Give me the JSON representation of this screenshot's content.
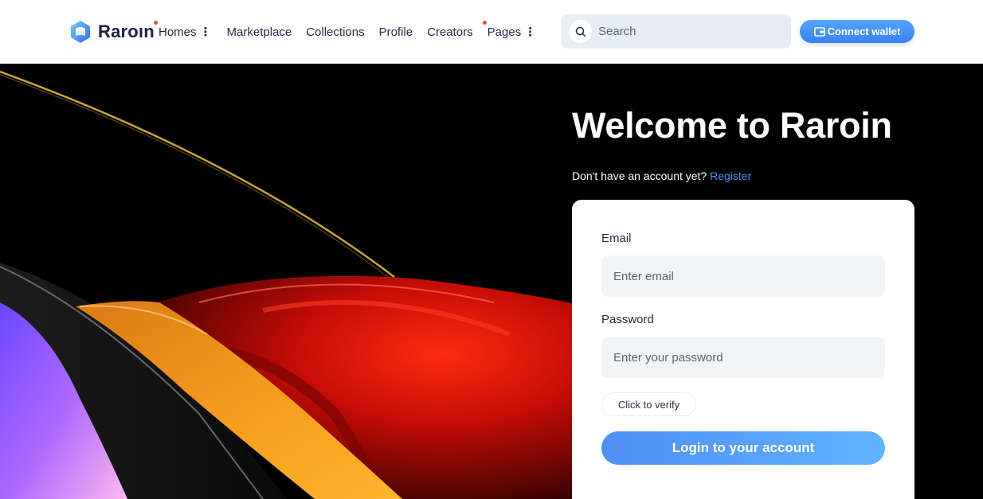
{
  "brand": {
    "name": "Raroın",
    "accent": "#4f8ff7"
  },
  "nav": {
    "items": [
      {
        "label": "Homes",
        "has_dot": true,
        "has_more": true
      },
      {
        "label": "Marketplace",
        "has_dot": false,
        "has_more": false
      },
      {
        "label": "Collections",
        "has_dot": false,
        "has_more": false
      },
      {
        "label": "Profile",
        "has_dot": false,
        "has_more": false
      },
      {
        "label": "Creators",
        "has_dot": false,
        "has_more": false
      },
      {
        "label": "Pages",
        "has_dot": true,
        "has_more": true
      }
    ],
    "more_glyph": "⋮"
  },
  "search": {
    "placeholder": "Search",
    "icon": "search-icon"
  },
  "wallet": {
    "label": "Connect wallet",
    "icon": "wallet-icon"
  },
  "hero": {
    "title": "Welcome to Raroin",
    "subtitle_prefix": "Don't have an account yet?",
    "register_link": "Register"
  },
  "form": {
    "email_label": "Email",
    "email_placeholder": "Enter email",
    "password_label": "Password",
    "password_placeholder": "Enter your password",
    "verify_label": "Click to verify",
    "submit_label": "Login to your account"
  }
}
